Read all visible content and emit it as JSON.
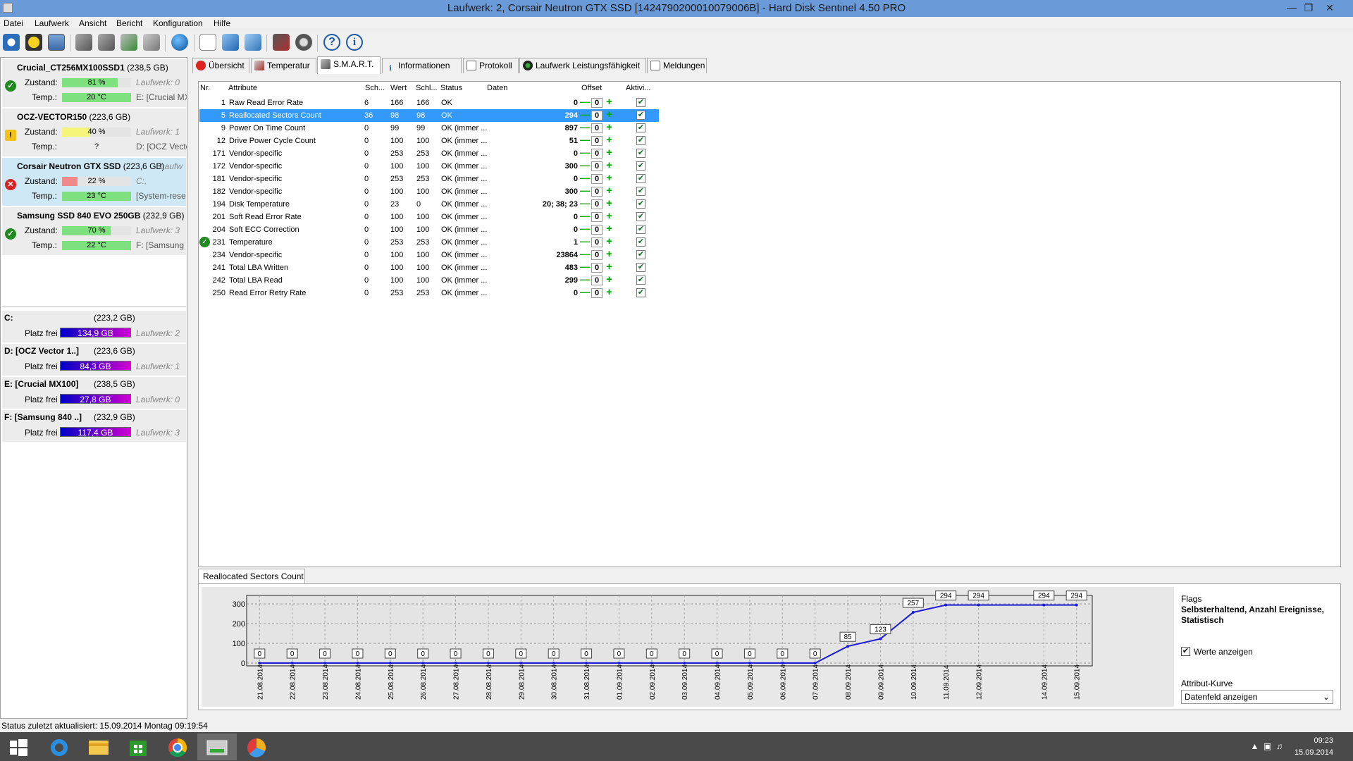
{
  "window": {
    "title": "Laufwerk: 2, Corsair Neutron GTX SSD [1424790200010079006B]  -  Hard Disk Sentinel 4.50 PRO"
  },
  "menu": [
    "Datei",
    "Laufwerk",
    "Ansicht",
    "Bericht",
    "Konfiguration",
    "Hilfe"
  ],
  "disks": [
    {
      "name": "Crucial_CT256MX100SSD1",
      "size": "(238,5 GB)",
      "status": "ok",
      "zustand_label": "Zustand:",
      "zustand": "81 %",
      "health": 0.81,
      "temp_label": "Temp.:",
      "temp": "20 °C",
      "drive": "Laufwerk: 0",
      "vol": "E: [Crucial MX"
    },
    {
      "name": "OCZ-VECTOR150",
      "size": "(223,6 GB)",
      "status": "warn",
      "zustand_label": "Zustand:",
      "zustand": "40 %",
      "health": 0.4,
      "temp_label": "Temp.:",
      "temp": "?",
      "drive": "Laufwerk: 1",
      "vol": "D: [OCZ Vecto"
    },
    {
      "name": "Corsair Neutron GTX SSD",
      "size": "(223,6 GB)",
      "status": "bad",
      "zustand_label": "Zustand:",
      "zustand": "22 %",
      "health": 0.22,
      "temp_label": "Temp.:",
      "temp": "23 °C",
      "drive": "C:,",
      "vol": "[System-rese",
      "extra": "Laufw"
    },
    {
      "name": "Samsung SSD 840 EVO 250GB",
      "size": "(232,9 GB)",
      "status": "ok",
      "zustand_label": "Zustand:",
      "zustand": "70 %",
      "health": 0.7,
      "temp_label": "Temp.:",
      "temp": "22 °C",
      "drive": "Laufwerk: 3",
      "vol": "F: [Samsung 8"
    }
  ],
  "volumes": [
    {
      "name": "C:",
      "size": "(223,2 GB)",
      "free_label": "Platz frei",
      "free": "134,9 GB",
      "drive": "Laufwerk: 2"
    },
    {
      "name": "D: [OCZ Vector 1..]",
      "size": "(223,6 GB)",
      "free_label": "Platz frei",
      "free": "84,3 GB",
      "drive": "Laufwerk: 1"
    },
    {
      "name": "E: [Crucial MX100]",
      "size": "(238,5 GB)",
      "free_label": "Platz frei",
      "free": "27,8 GB",
      "drive": "Laufwerk: 0"
    },
    {
      "name": "F: [Samsung 840 ..]",
      "size": "(232,9 GB)",
      "free_label": "Platz frei",
      "free": "117,4 GB",
      "drive": "Laufwerk: 3"
    }
  ],
  "tabs": [
    "Übersicht",
    "Temperatur",
    "S.M.A.R.T.",
    "Informationen",
    "Protokoll",
    "Laufwerk Leistungsfähigkeit",
    "Meldungen"
  ],
  "grid": {
    "headers": {
      "nr": "Nr.",
      "attr": "Attribute",
      "sch": "Sch...",
      "wert": "Wert",
      "schl": "Schl...",
      "status": "Status",
      "daten": "Daten",
      "offset": "Offset",
      "aktiv": "Aktivi..."
    },
    "rows": [
      {
        "nr": "1",
        "name": "Raw Read Error Rate",
        "sch": "6",
        "wert": "166",
        "schl": "166",
        "status": "OK",
        "data": "0",
        "offset": "0"
      },
      {
        "nr": "5",
        "name": "Reallocated Sectors Count",
        "sch": "36",
        "wert": "98",
        "schl": "98",
        "status": "OK",
        "data": "294",
        "offset": "0"
      },
      {
        "nr": "9",
        "name": "Power On Time Count",
        "sch": "0",
        "wert": "99",
        "schl": "99",
        "status": "OK (immer ...",
        "data": "897",
        "offset": "0"
      },
      {
        "nr": "12",
        "name": "Drive Power Cycle Count",
        "sch": "0",
        "wert": "100",
        "schl": "100",
        "status": "OK (immer ...",
        "data": "51",
        "offset": "0"
      },
      {
        "nr": "171",
        "name": "Vendor-specific",
        "sch": "0",
        "wert": "253",
        "schl": "253",
        "status": "OK (immer ...",
        "data": "0",
        "offset": "0"
      },
      {
        "nr": "172",
        "name": "Vendor-specific",
        "sch": "0",
        "wert": "100",
        "schl": "100",
        "status": "OK (immer ...",
        "data": "300",
        "offset": "0"
      },
      {
        "nr": "181",
        "name": "Vendor-specific",
        "sch": "0",
        "wert": "253",
        "schl": "253",
        "status": "OK (immer ...",
        "data": "0",
        "offset": "0"
      },
      {
        "nr": "182",
        "name": "Vendor-specific",
        "sch": "0",
        "wert": "100",
        "schl": "100",
        "status": "OK (immer ...",
        "data": "300",
        "offset": "0"
      },
      {
        "nr": "194",
        "name": "Disk Temperature",
        "sch": "0",
        "wert": "23",
        "schl": "0",
        "status": "OK (immer ...",
        "data": "20; 38; 23",
        "offset": "0"
      },
      {
        "nr": "201",
        "name": "Soft Read Error Rate",
        "sch": "0",
        "wert": "100",
        "schl": "100",
        "status": "OK (immer ...",
        "data": "0",
        "offset": "0"
      },
      {
        "nr": "204",
        "name": "Soft ECC Correction",
        "sch": "0",
        "wert": "100",
        "schl": "100",
        "status": "OK (immer ...",
        "data": "0",
        "offset": "0"
      },
      {
        "nr": "231",
        "name": "Temperature",
        "sch": "0",
        "wert": "253",
        "schl": "253",
        "status": "OK (immer ...",
        "data": "1",
        "offset": "0"
      },
      {
        "nr": "234",
        "name": "Vendor-specific",
        "sch": "0",
        "wert": "100",
        "schl": "100",
        "status": "OK (immer ...",
        "data": "23864",
        "offset": "0"
      },
      {
        "nr": "241",
        "name": "Total LBA Written",
        "sch": "0",
        "wert": "100",
        "schl": "100",
        "status": "OK (immer ...",
        "data": "483",
        "offset": "0"
      },
      {
        "nr": "242",
        "name": "Total LBA Read",
        "sch": "0",
        "wert": "100",
        "schl": "100",
        "status": "OK (immer ...",
        "data": "299",
        "offset": "0"
      },
      {
        "nr": "250",
        "name": "Read Error Retry Rate",
        "sch": "0",
        "wert": "253",
        "schl": "253",
        "status": "OK (immer ...",
        "data": "0",
        "offset": "0"
      }
    ]
  },
  "chart_panel": {
    "tab": "Reallocated Sectors Count"
  },
  "chart_data": {
    "type": "line",
    "title": "",
    "x": [
      "21.08.2014",
      "22.08.2014",
      "23.08.2014",
      "24.08.2014",
      "25.08.2014",
      "26.08.2014",
      "27.08.2014",
      "28.08.2014",
      "29.08.2014",
      "30.08.2014",
      "31.08.2014",
      "01.09.2014",
      "02.09.2014",
      "03.09.2014",
      "04.09.2014",
      "05.09.2014",
      "06.09.2014",
      "07.09.2014",
      "08.09.2014",
      "09.09.2014",
      "10.09.2014",
      "11.09.2014",
      "12.09.2014",
      "14.09.2014",
      "15.09.2014"
    ],
    "x_index": [
      0,
      1,
      2,
      3,
      4,
      5,
      6,
      7,
      8,
      9,
      10,
      11,
      12,
      13,
      14,
      15,
      16,
      17,
      18,
      19,
      20,
      21,
      22,
      24,
      25
    ],
    "values": [
      0,
      0,
      0,
      0,
      0,
      0,
      0,
      0,
      0,
      0,
      0,
      0,
      0,
      0,
      0,
      0,
      0,
      0,
      85,
      123,
      257,
      294,
      294,
      294,
      294
    ],
    "yticks": [
      "300",
      "200",
      "100",
      "0"
    ],
    "ylim": [
      0,
      300
    ],
    "grid": true,
    "line_color": "#1c1cd6"
  },
  "flags": {
    "label": "Flags",
    "value": "Selbsterhaltend, Anzahl Ereignisse, Statistisch",
    "show_values": "Werte anzeigen",
    "curve_label": "Attribut-Kurve",
    "curve_value": "Datenfeld anzeigen"
  },
  "status": "Status zuletzt aktualisiert: 15.09.2014 Montag 09:19:54",
  "clock": {
    "time": "09:23",
    "date": "15.09.2014"
  }
}
